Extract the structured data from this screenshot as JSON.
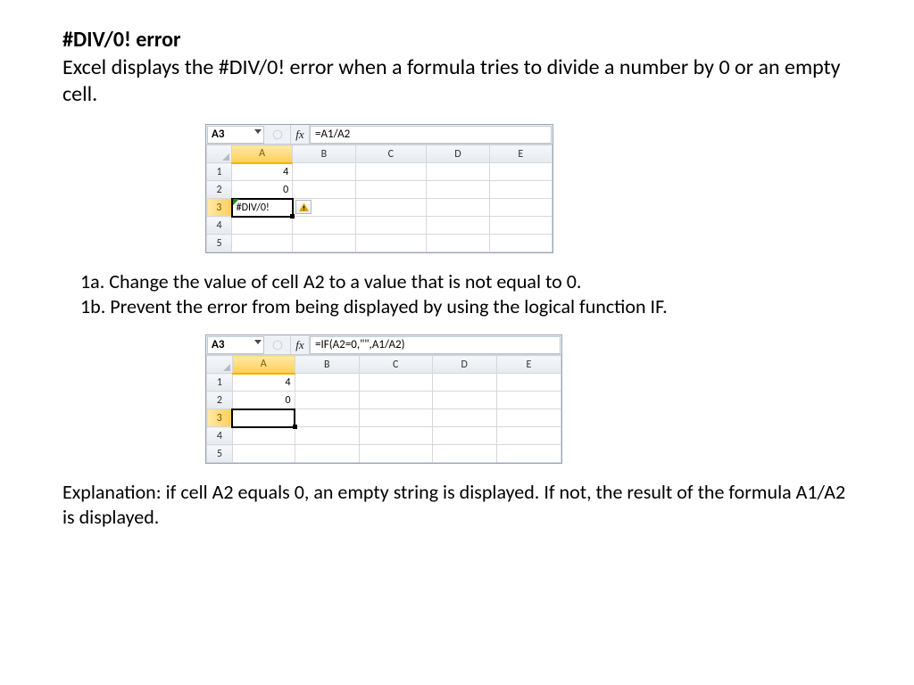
{
  "title": "#DIV/0! error",
  "intro": "Excel displays the #DIV/0! error when a formula tries to divide a number by 0 or an empty cell.",
  "step_a": "1a. Change the value of cell A2 to a value that is not equal to 0.",
  "step_b": "1b. Prevent the error from being displayed by using the logical function IF.",
  "explanation": "Explanation: if cell A2 equals 0, an empty string is displayed. If not, the result of the formula A1/A2 is displayed.",
  "excel1": {
    "namebox": "A3",
    "fx_label": "fx",
    "formula": "=A1/A2",
    "cols": [
      "A",
      "B",
      "C",
      "D",
      "E"
    ],
    "rows": [
      "1",
      "2",
      "3",
      "4",
      "5"
    ],
    "a1": "4",
    "a2": "0",
    "a3": "#DIV/0!"
  },
  "excel2": {
    "namebox": "A3",
    "fx_label": "fx",
    "formula": "=IF(A2=0,\"\",A1/A2)",
    "cols": [
      "A",
      "B",
      "C",
      "D",
      "E"
    ],
    "rows": [
      "1",
      "2",
      "3",
      "4",
      "5"
    ],
    "a1": "4",
    "a2": "0",
    "a3": ""
  }
}
